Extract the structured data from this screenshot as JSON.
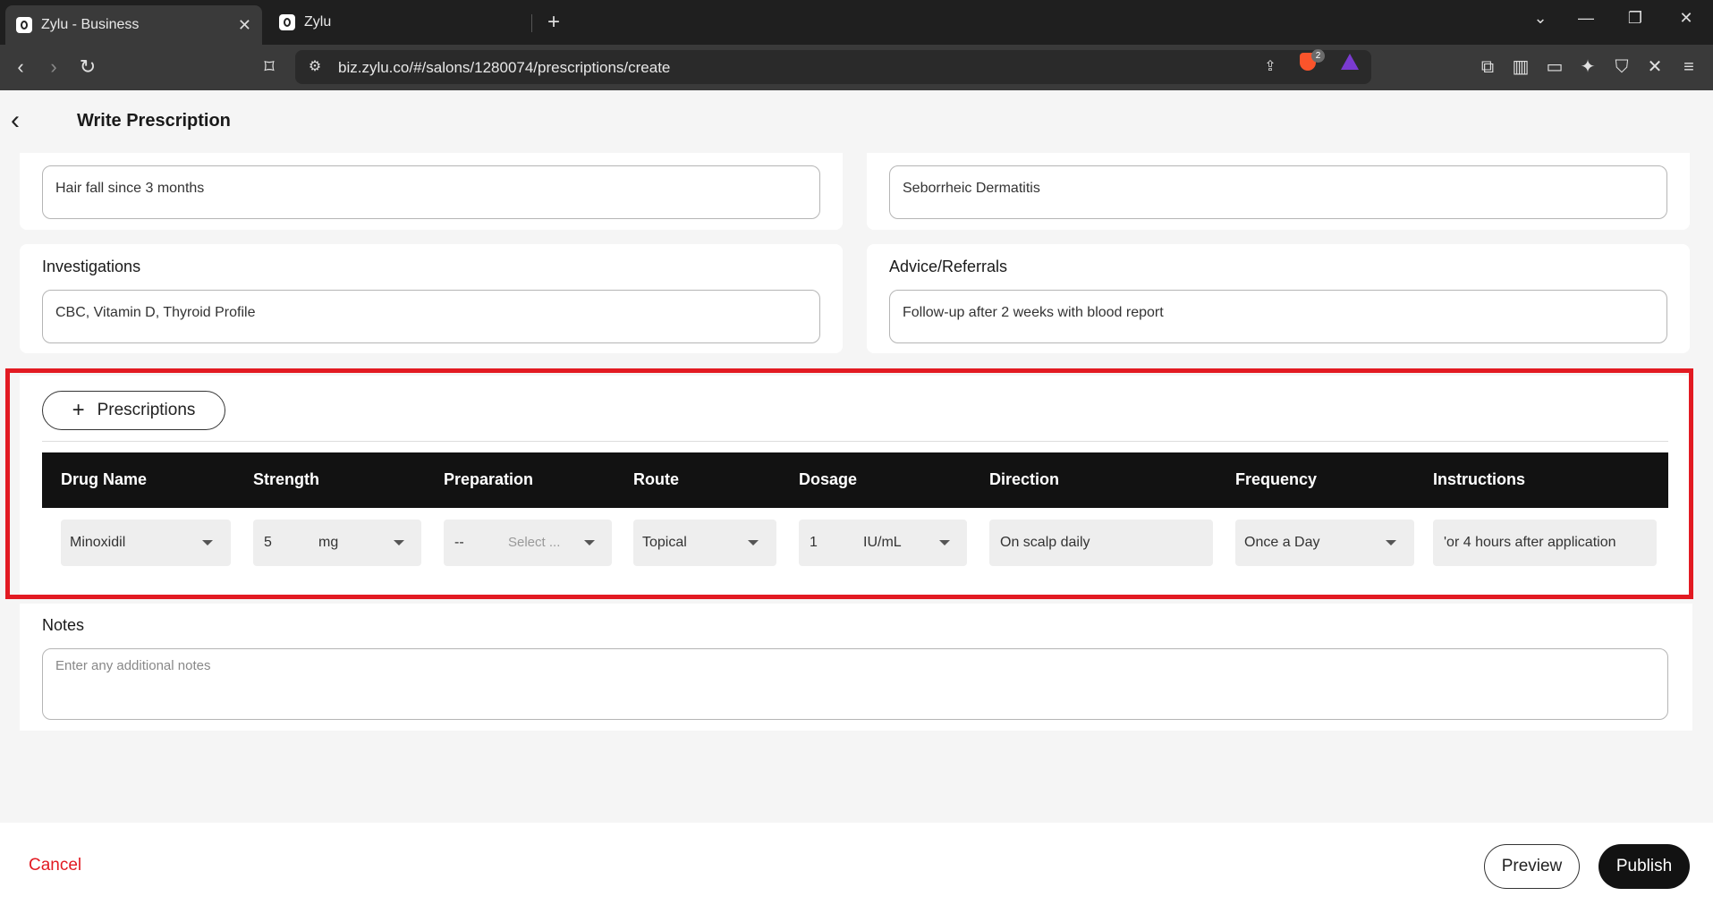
{
  "browser": {
    "tabs": [
      {
        "title": "Zylu - Business",
        "active": true
      },
      {
        "title": "Zylu",
        "active": false
      }
    ],
    "url": "biz.zylu.co/#/salons/1280074/prescriptions/create",
    "brave_badge": "2"
  },
  "header": {
    "title": "Write Prescription"
  },
  "fields": {
    "complaints_value": "Hair fall since 3 months",
    "diagnosis_value": "Seborrheic Dermatitis",
    "investigations_label": "Investigations",
    "investigations_value": "CBC, Vitamin D, Thyroid Profile",
    "advice_label": "Advice/Referrals",
    "advice_value": "Follow-up after 2 weeks with blood report"
  },
  "prescriptions": {
    "add_label": "Prescriptions",
    "columns": [
      "Drug Name",
      "Strength",
      "Preparation",
      "Route",
      "Dosage",
      "Direction",
      "Frequency",
      "Instructions"
    ],
    "row": {
      "drug_name": "Minoxidil",
      "strength_value": "5",
      "strength_unit": "mg",
      "preparation_value": "--",
      "preparation_placeholder": "Select ...",
      "route": "Topical",
      "dosage_value": "1",
      "dosage_unit": "IU/mL",
      "direction": "On scalp daily",
      "frequency": "Once a Day",
      "instructions": "'or 4 hours after application"
    }
  },
  "notes": {
    "label": "Notes",
    "placeholder": "Enter any additional notes"
  },
  "footer": {
    "cancel_label": "Cancel",
    "preview_label": "Preview",
    "publish_label": "Publish"
  },
  "colors": {
    "accent_red": "#e21a22",
    "table_header": "#121212"
  }
}
